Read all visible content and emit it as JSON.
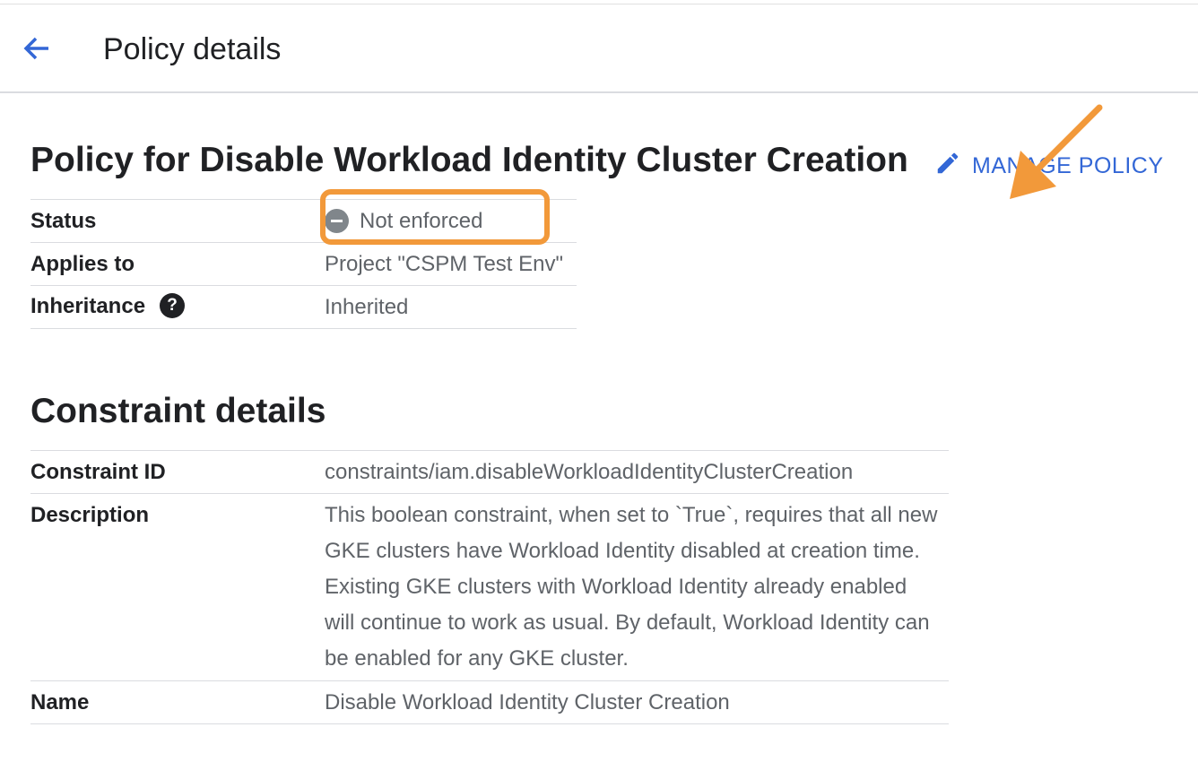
{
  "header": {
    "back_icon": "arrow-back-icon",
    "title": "Policy details"
  },
  "policy": {
    "heading": "Policy for Disable Workload Identity Cluster Creation",
    "manage_label": "MANAGE POLICY",
    "manage_icon": "pencil-icon",
    "rows": {
      "status": {
        "label": "Status",
        "value": "Not enforced",
        "icon": "not-enforced-icon"
      },
      "applies_to": {
        "label": "Applies to",
        "value": "Project \"CSPM Test Env\""
      },
      "inheritance": {
        "label": "Inheritance",
        "value": "Inherited",
        "help_glyph": "?"
      }
    }
  },
  "constraint": {
    "heading": "Constraint details",
    "rows": {
      "id": {
        "label": "Constraint ID",
        "value": "constraints/iam.disableWorkloadIdentityClusterCreation"
      },
      "description": {
        "label": "Description",
        "value": "This boolean constraint, when set to `True`, requires that all new GKE clusters have Workload Identity disabled at creation time. Existing GKE clusters with Workload Identity already enabled will continue to work as usual. By default, Workload Identity can be enabled for any GKE cluster."
      },
      "name": {
        "label": "Name",
        "value": "Disable Workload Identity Cluster Creation"
      }
    }
  },
  "annotations": {
    "highlight_color": "#f2993a",
    "arrow_color": "#f2993a"
  },
  "colors": {
    "accent": "#3367d6",
    "text_primary": "#202124",
    "text_secondary": "#5f6368",
    "divider": "#dadce0"
  }
}
